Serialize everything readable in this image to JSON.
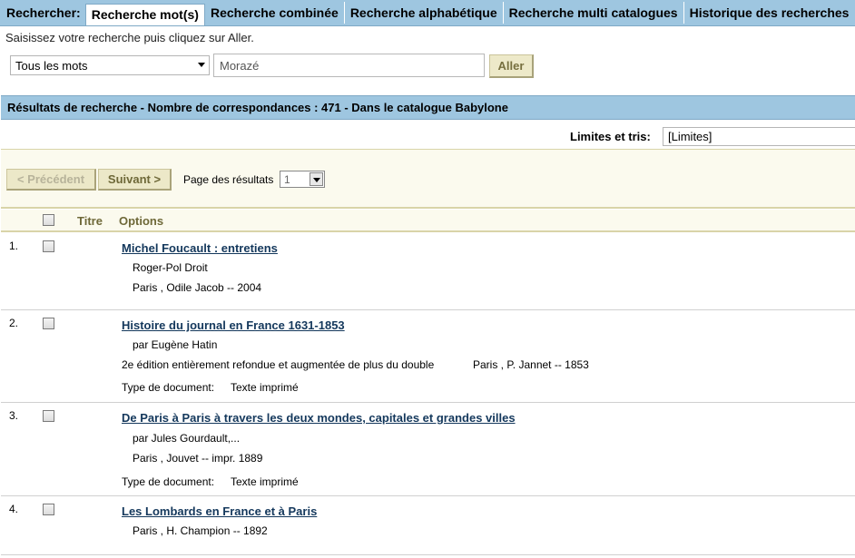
{
  "topbar": {
    "label": "Rechercher:",
    "tabs": [
      {
        "label": "Recherche mot(s)",
        "active": true
      },
      {
        "label": "Recherche combinée",
        "active": false
      },
      {
        "label": "Recherche alphabétique",
        "active": false
      },
      {
        "label": "Recherche multi catalogues",
        "active": false
      },
      {
        "label": "Historique des recherches",
        "active": false
      }
    ]
  },
  "search": {
    "instructions": "Saisissez votre recherche puis cliquez sur Aller.",
    "mode": "Tous les mots",
    "query": "Morazé",
    "go_label": "Aller"
  },
  "results": {
    "header": "Résultats de recherche - Nombre de correspondances : 471 - Dans le catalogue Babylone",
    "limits_label": "Limites et tris:",
    "limits_value": "[Limites]",
    "prev_label": "< Précédent",
    "next_label": "Suivant >",
    "page_label": "Page des résultats",
    "page_value": "1",
    "col_title": "Titre",
    "col_options": "Options",
    "items": [
      {
        "num": "1.",
        "title": "Michel Foucault : entretiens",
        "author": "Roger-Pol Droit",
        "publication": "Paris , Odile Jacob -- 2004"
      },
      {
        "num": "2.",
        "title": "Histoire du journal en France 1631-1853",
        "author": "par Eugène Hatin",
        "edition": "2e édition entièrement refondue et augmentée de plus du double",
        "publication": "Paris , P. Jannet -- 1853",
        "doctype_label": "Type de document:",
        "doctype": "Texte imprimé"
      },
      {
        "num": "3.",
        "title": "De Paris à Paris à travers les deux mondes, capitales et grandes villes",
        "author": "par Jules Gourdault,...",
        "publication": "Paris , Jouvet -- impr. 1889",
        "doctype_label": "Type de document:",
        "doctype": "Texte imprimé"
      },
      {
        "num": "4.",
        "title": "Les Lombards en France et à Paris",
        "publication": "Paris , H. Champion -- 1892"
      }
    ]
  }
}
